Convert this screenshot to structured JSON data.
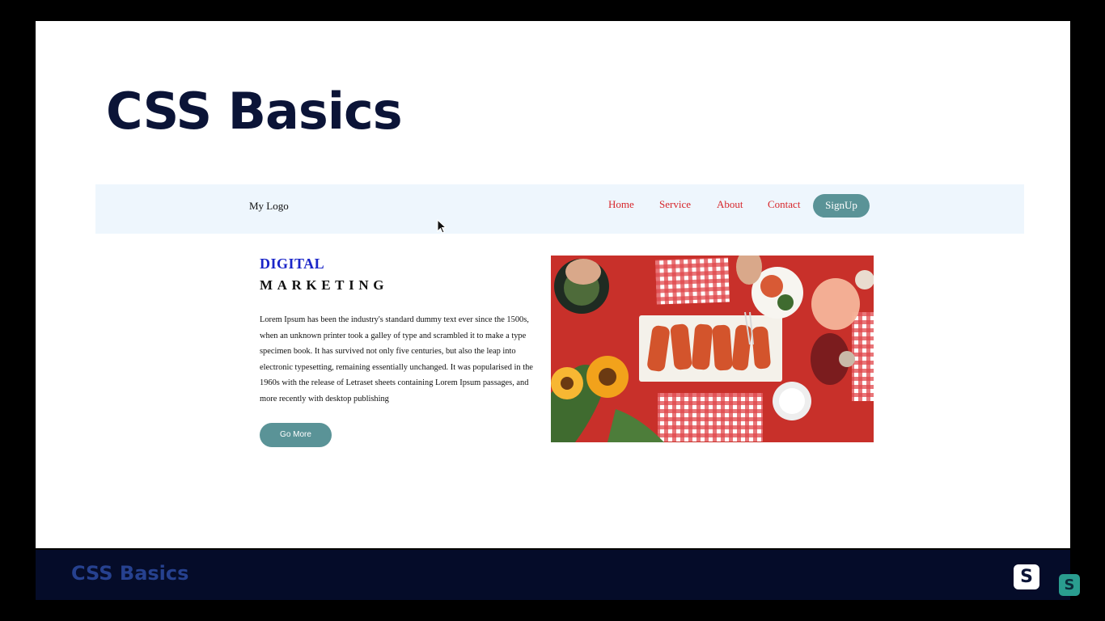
{
  "slide": {
    "title": "CSS Basics"
  },
  "webpage": {
    "logo": "My Logo",
    "nav": {
      "home": "Home",
      "service": "Service",
      "about": "About",
      "contact": "Contact",
      "signup": "SignUp"
    },
    "hero": {
      "heading_line1": "DIGITAL",
      "heading_line2": "MARKETING",
      "paragraph": "Lorem Ipsum has been the industry's standard dummy text ever since the 1500s, when an unknown printer took a galley of type and scrambled it to make a type specimen book. It has survived not only five centuries, but also the leap into electronic typesetting, remaining essentially unchanged. It was popularised in the 1960s with the release of Letraset sheets containing Lorem Ipsum passages, and more recently with desktop publishing",
      "button": "Go More",
      "image_icon": "food-table-photo"
    }
  },
  "footer": {
    "title": "CSS Basics",
    "badge_letter": "S",
    "badge2_letter": "S"
  },
  "colors": {
    "slide_title": "#0b1437",
    "nav_bg": "#eef6fd",
    "nav_link": "#d7262b",
    "button_teal": "#5a9397",
    "heading_blue": "#1a25c8",
    "footer_bg": "#050c29",
    "footer_text": "#26418f",
    "image_bg": "#c8302a"
  }
}
